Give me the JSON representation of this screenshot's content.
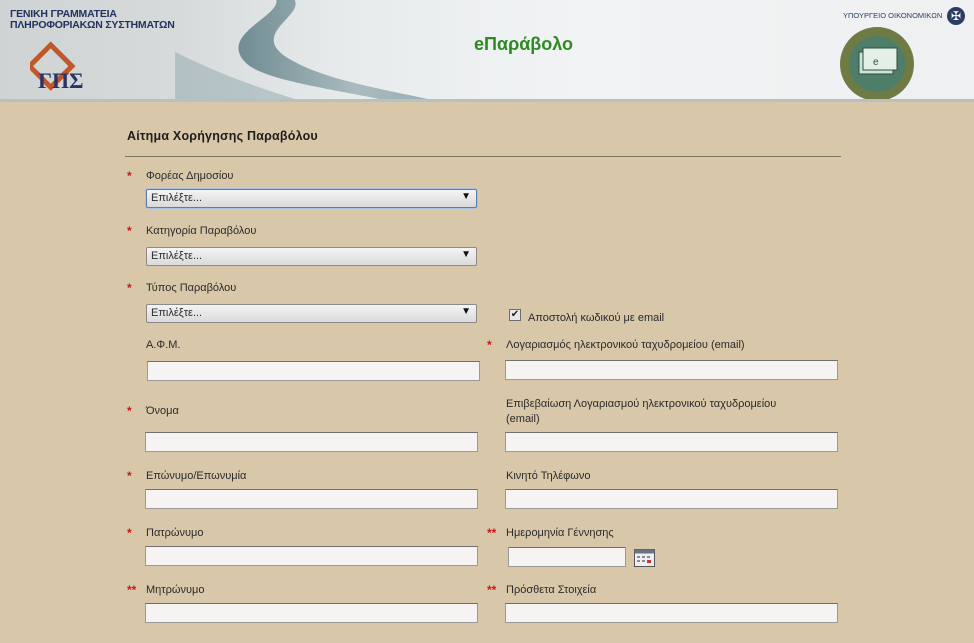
{
  "header": {
    "org_line1": "ΓΕΝΙΚΗ ΓΡΑΜΜΑΤΕΙΑ",
    "org_line2": "ΠΛΗΡΟΦΟΡΙΑΚΩΝ ΣΥΣΤΗΜΑΤΩΝ",
    "app_title": "eΠαράβολο",
    "ministry": "ΥΠΟΥΡΓΕΙΟ ΟΙΚΟΝΟΜΙΚΩΝ",
    "seal_text": "e-ΠΑΡΑΒΟΛΟ"
  },
  "form": {
    "title": "Αίτημα Χορήγησης Παραβόλου",
    "required_mark": "*",
    "double_mark": "**",
    "select_placeholder": "Επιλέξτε...",
    "fields": {
      "foreas": "Φορέας Δημοσίου",
      "category": "Κατηγορία Παραβόλου",
      "type": "Τύπος Παραβόλου",
      "send_email_code": "Αποστολή κωδικού με email",
      "afm": "Α.Φ.Μ.",
      "email": "Λογαριασμός ηλεκτρονικού ταχυδρομείου (email)",
      "name": "Όνομα",
      "email_confirm_line1": "Επιβεβαίωση Λογαριασμού ηλεκτρονικού ταχυδρομείου",
      "email_confirm_line2": "(email)",
      "surname": "Επώνυμο/Επωνυμία",
      "mobile": "Κινητό Τηλέφωνο",
      "father": "Πατρώνυμο",
      "birthdate": "Ημερομηνία Γέννησης",
      "mother": "Μητρώνυμο",
      "extra": "Πρόσθετα Στοιχεία"
    },
    "send_email_checked": true
  }
}
